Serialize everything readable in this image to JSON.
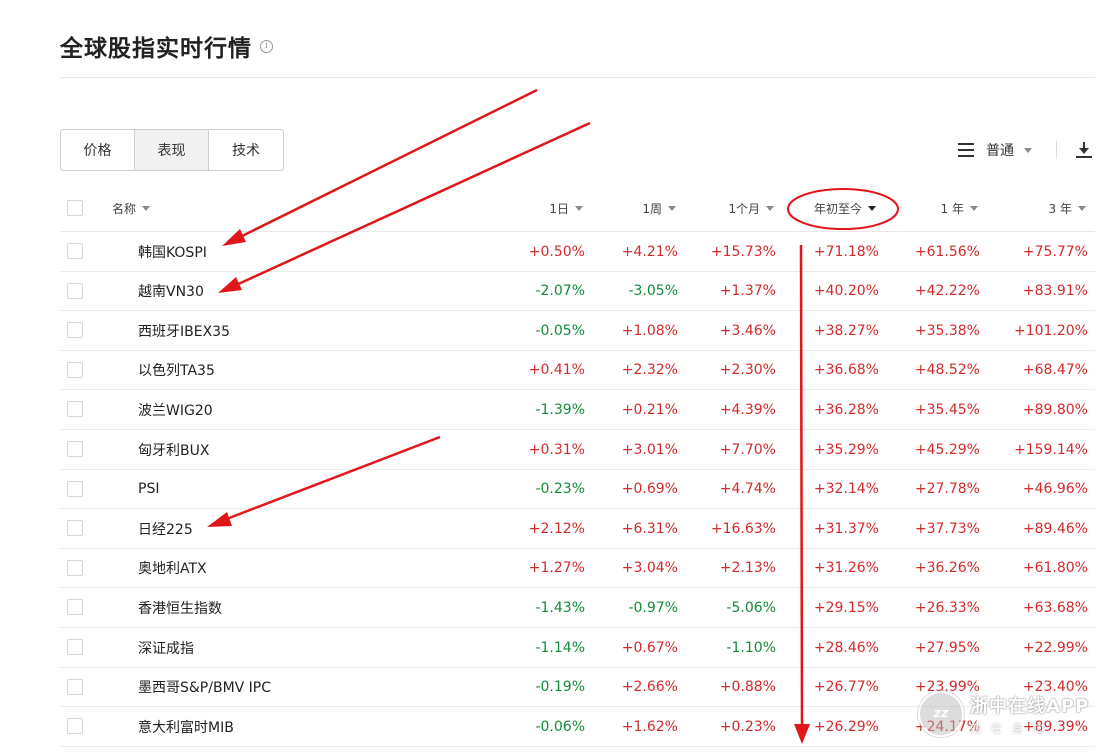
{
  "page": {
    "title": "全球股指实时行情",
    "info_icon": "i"
  },
  "tabs": [
    {
      "label": "价格",
      "active": false
    },
    {
      "label": "表现",
      "active": true
    },
    {
      "label": "技术",
      "active": false
    }
  ],
  "toolbar": {
    "view_label": "普通",
    "icons": [
      "menu-icon",
      "download-icon"
    ]
  },
  "table": {
    "columns": {
      "name": "名称",
      "d1": "1日",
      "w1": "1周",
      "m1": "1个月",
      "ytd": "年初至今",
      "y1": "1 年",
      "y3": "3 年"
    },
    "sorted_column": "ytd",
    "rows": [
      {
        "name": "韩国KOSPI",
        "d1": "+0.50%",
        "w1": "+4.21%",
        "m1": "+15.73%",
        "ytd": "+71.18%",
        "y1": "+61.56%",
        "y3": "+75.77%"
      },
      {
        "name": "越南VN30",
        "d1": "-2.07%",
        "w1": "-3.05%",
        "m1": "+1.37%",
        "ytd": "+40.20%",
        "y1": "+42.22%",
        "y3": "+83.91%"
      },
      {
        "name": "西班牙IBEX35",
        "d1": "-0.05%",
        "w1": "+1.08%",
        "m1": "+3.46%",
        "ytd": "+38.27%",
        "y1": "+35.38%",
        "y3": "+101.20%"
      },
      {
        "name": "以色列TA35",
        "d1": "+0.41%",
        "w1": "+2.32%",
        "m1": "+2.30%",
        "ytd": "+36.68%",
        "y1": "+48.52%",
        "y3": "+68.47%"
      },
      {
        "name": "波兰WIG20",
        "d1": "-1.39%",
        "w1": "+0.21%",
        "m1": "+4.39%",
        "ytd": "+36.28%",
        "y1": "+35.45%",
        "y3": "+89.80%"
      },
      {
        "name": "匈牙利BUX",
        "d1": "+0.31%",
        "w1": "+3.01%",
        "m1": "+7.70%",
        "ytd": "+35.29%",
        "y1": "+45.29%",
        "y3": "+159.14%"
      },
      {
        "name": "PSI",
        "d1": "-0.23%",
        "w1": "+0.69%",
        "m1": "+4.74%",
        "ytd": "+32.14%",
        "y1": "+27.78%",
        "y3": "+46.96%"
      },
      {
        "name": "日经225",
        "d1": "+2.12%",
        "w1": "+6.31%",
        "m1": "+16.63%",
        "ytd": "+31.37%",
        "y1": "+37.73%",
        "y3": "+89.46%"
      },
      {
        "name": "奥地利ATX",
        "d1": "+1.27%",
        "w1": "+3.04%",
        "m1": "+2.13%",
        "ytd": "+31.26%",
        "y1": "+36.26%",
        "y3": "+61.80%"
      },
      {
        "name": "香港恒生指数",
        "d1": "-1.43%",
        "w1": "-0.97%",
        "m1": "-5.06%",
        "ytd": "+29.15%",
        "y1": "+26.33%",
        "y3": "+63.68%"
      },
      {
        "name": "深证成指",
        "d1": "-1.14%",
        "w1": "+0.67%",
        "m1": "-1.10%",
        "ytd": "+28.46%",
        "y1": "+27.95%",
        "y3": "+22.99%"
      },
      {
        "name": "墨西哥S&P/BMV IPC",
        "d1": "-0.19%",
        "w1": "+2.66%",
        "m1": "+0.88%",
        "ytd": "+26.77%",
        "y1": "+23.99%",
        "y3": "+23.40%"
      },
      {
        "name": "意大利富时MIB",
        "d1": "-0.06%",
        "w1": "+1.62%",
        "m1": "+0.23%",
        "ytd": "+26.29%",
        "y1": "+24.17%",
        "y3": "+89.39%"
      }
    ]
  },
  "colors": {
    "positive": "#d22b2b",
    "negative": "#158a3a",
    "annotation": "#e0161b"
  },
  "watermark": {
    "name": "浙中在线APP",
    "slogan": "就在身边"
  }
}
